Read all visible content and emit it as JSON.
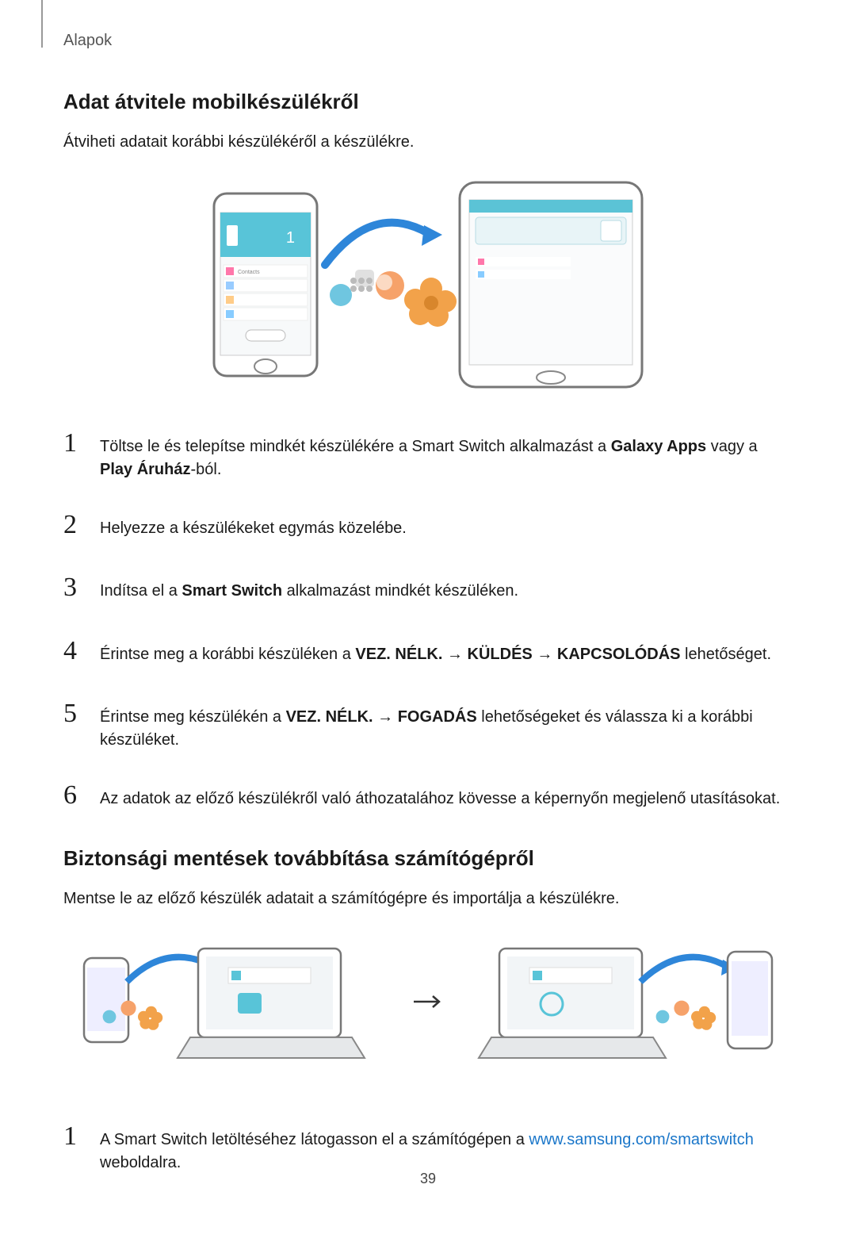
{
  "header": {
    "label": "Alapok"
  },
  "section1": {
    "title": "Adat átvitele mobilkészülékről",
    "intro": "Átviheti adatait korábbi készülékéről a készülékre.",
    "steps": [
      {
        "n": "1",
        "pre": "Töltse le és telepítse mindkét készülékére a Smart Switch alkalmazást a ",
        "b1": "Galaxy Apps",
        "mid": " vagy a ",
        "b2": "Play Áruház",
        "post": "-ból."
      },
      {
        "n": "2",
        "text": "Helyezze a készülékeket egymás közelébe."
      },
      {
        "n": "3",
        "pre": "Indítsa el a ",
        "b1": "Smart Switch",
        "post": " alkalmazást mindkét készüléken."
      },
      {
        "n": "4",
        "pre": "Érintse meg a korábbi készüléken a ",
        "b1": "VEZ. NÉLK.",
        "mid1": " → ",
        "b2": "KÜLDÉS",
        "mid2": " → ",
        "b3": "KAPCSOLÓDÁS",
        "post": " lehetőséget."
      },
      {
        "n": "5",
        "pre": "Érintse meg készülékén a ",
        "b1": "VEZ. NÉLK.",
        "mid1": " → ",
        "b2": "FOGADÁS",
        "post": " lehetőségeket és válassza ki a korábbi készüléket."
      },
      {
        "n": "6",
        "text": "Az adatok az előző készülékről való áthozatalához kövesse a képernyőn megjelenő utasításokat."
      }
    ]
  },
  "section2": {
    "title": "Biztonsági mentések továbbítása számítógépről",
    "intro": "Mentse le az előző készülék adatait a számítógépre és importálja a készülékre.",
    "steps": [
      {
        "n": "1",
        "pre": "A Smart Switch letöltéséhez látogasson el a számítógépen a ",
        "link": "www.samsung.com/smartswitch",
        "post": " weboldalra."
      }
    ]
  },
  "pageNumber": "39"
}
